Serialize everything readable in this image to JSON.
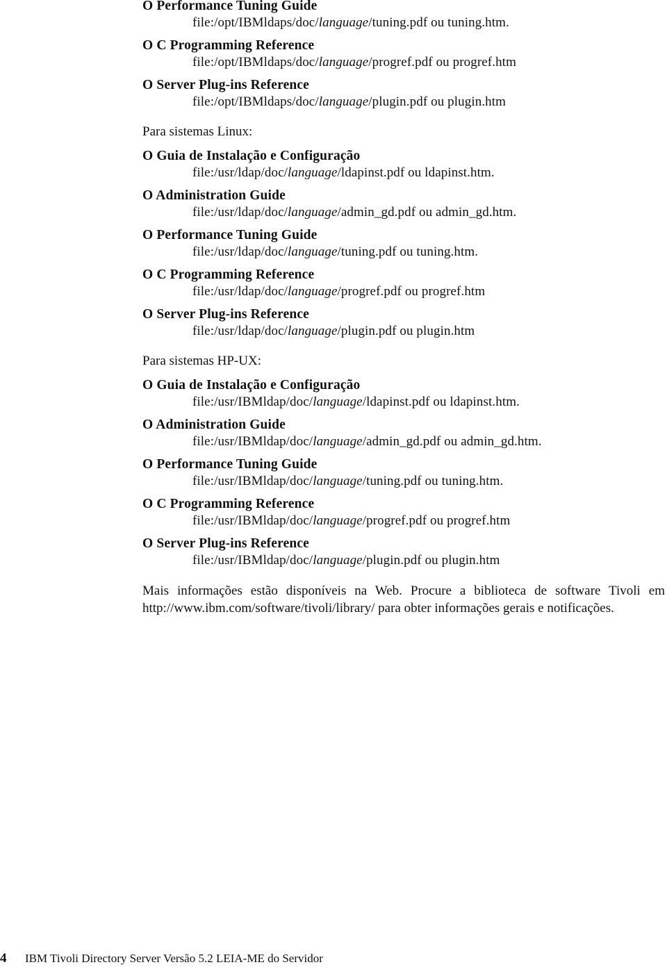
{
  "sections": [
    {
      "label": "",
      "entries": [
        {
          "title": "O Performance Tuning Guide",
          "path_prefix": "file:/opt/IBMldaps/doc/",
          "path_lang": "language",
          "path_suffix": "/tuning.pdf ou tuning.htm."
        },
        {
          "title": "O C Programming Reference",
          "path_prefix": "file:/opt/IBMldaps/doc/",
          "path_lang": "language",
          "path_suffix": "/progref.pdf ou progref.htm"
        },
        {
          "title": "O Server Plug-ins Reference",
          "path_prefix": "file:/opt/IBMldaps/doc/",
          "path_lang": "language",
          "path_suffix": "/plugin.pdf ou plugin.htm"
        }
      ]
    },
    {
      "label": "Para sistemas Linux:",
      "entries": [
        {
          "title": "O Guia de Instalação e Configuração",
          "path_prefix": "file:/usr/ldap/doc/",
          "path_lang": "language",
          "path_suffix": "/ldapinst.pdf ou ldapinst.htm."
        },
        {
          "title": "O Administration Guide",
          "path_prefix": "file:/usr/ldap/doc/",
          "path_lang": "language",
          "path_suffix": "/admin_gd.pdf ou admin_gd.htm."
        },
        {
          "title": "O Performance Tuning Guide",
          "path_prefix": "file:/usr/ldap/doc/",
          "path_lang": "language",
          "path_suffix": "/tuning.pdf ou tuning.htm."
        },
        {
          "title": "O C Programming Reference",
          "path_prefix": "file:/usr/ldap/doc/",
          "path_lang": "language",
          "path_suffix": "/progref.pdf ou progref.htm"
        },
        {
          "title": "O Server Plug-ins Reference",
          "path_prefix": "file:/usr/ldap/doc/",
          "path_lang": "language",
          "path_suffix": "/plugin.pdf ou plugin.htm"
        }
      ]
    },
    {
      "label": "Para sistemas HP-UX:",
      "entries": [
        {
          "title": "O Guia de Instalação e Configuração",
          "path_prefix": "file:/usr/IBMldap/doc/",
          "path_lang": "language",
          "path_suffix": "/ldapinst.pdf ou ldapinst.htm."
        },
        {
          "title": "O Administration Guide",
          "path_prefix": "file:/usr/IBMldap/doc/",
          "path_lang": "language",
          "path_suffix": "/admin_gd.pdf ou admin_gd.htm."
        },
        {
          "title": "O Performance Tuning Guide",
          "path_prefix": "file:/usr/IBMldap/doc/",
          "path_lang": "language",
          "path_suffix": "/tuning.pdf ou tuning.htm."
        },
        {
          "title": "O C Programming Reference",
          "path_prefix": "file:/usr/IBMldap/doc/",
          "path_lang": "language",
          "path_suffix": "/progref.pdf ou progref.htm"
        },
        {
          "title": "O Server Plug-ins Reference",
          "path_prefix": "file:/usr/IBMldap/doc/",
          "path_lang": "language",
          "path_suffix": "/plugin.pdf ou plugin.htm"
        }
      ]
    }
  ],
  "info_paragraph": "Mais informações estão disponíveis na Web. Procure a biblioteca de software Tivoli em http://www.ibm.com/software/tivoli/library/ para obter informações gerais e notificações.",
  "footer": {
    "page_number": "4",
    "title": "IBM Tivoli Directory Server Versão 5.2 LEIA-ME do Servidor"
  }
}
